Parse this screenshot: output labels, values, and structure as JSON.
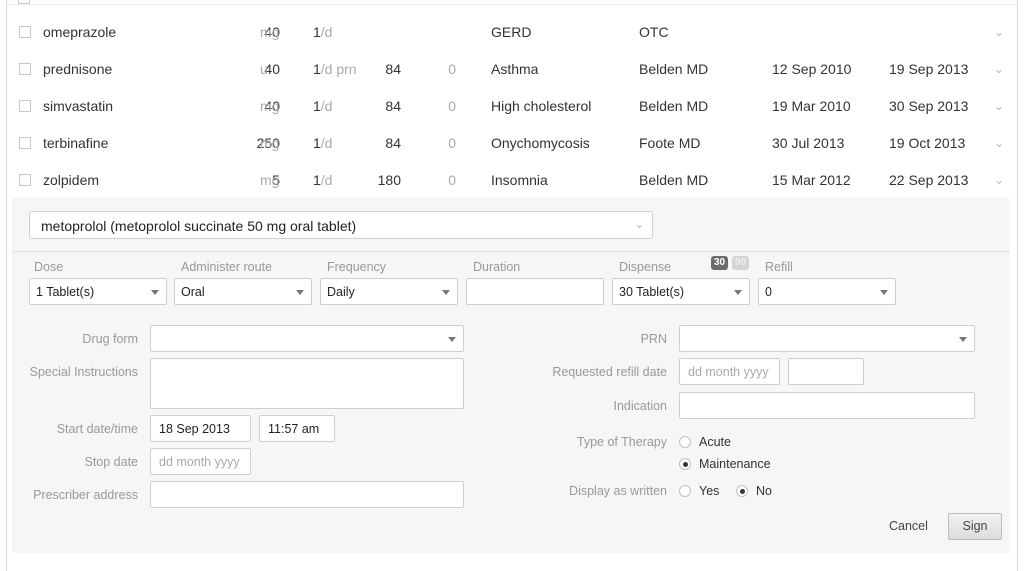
{
  "med_list": [
    {
      "name": "omeprazole",
      "dose": "40",
      "unit": "mg",
      "freq_num": "1",
      "freq_per": "/d",
      "quantity": "",
      "refills": "",
      "indication": "GERD",
      "prescriber": "OTC",
      "start": "",
      "end": ""
    },
    {
      "name": "prednisone",
      "dose": "40",
      "unit": "u",
      "freq_num": "1",
      "freq_per": "/d prn",
      "quantity": "84",
      "refills": "0",
      "indication": "Asthma",
      "prescriber": "Belden MD",
      "start": "12 Sep 2010",
      "end": "19 Sep 2013"
    },
    {
      "name": "simvastatin",
      "dose": "40",
      "unit": "mg",
      "freq_num": "1",
      "freq_per": "/d",
      "quantity": "84",
      "refills": "0",
      "indication": "High cholesterol",
      "prescriber": "Belden MD",
      "start": "19 Mar 2010",
      "end": "30 Sep 2013"
    },
    {
      "name": "terbinafine",
      "dose": "250",
      "unit": "mg",
      "freq_num": "1",
      "freq_per": "/d",
      "quantity": "84",
      "refills": "0",
      "indication": "Onychomycosis",
      "prescriber": "Foote MD",
      "start": "30  Jul  2013",
      "end": "19 Oct 2013"
    },
    {
      "name": "zolpidem",
      "dose": "5",
      "unit": "mg",
      "freq_num": "1",
      "freq_per": "/d",
      "quantity": "180",
      "refills": "0",
      "indication": "Insomnia",
      "prescriber": "Belden MD",
      "start": "15 Mar 2012",
      "end": "22 Sep 2013"
    }
  ],
  "order": {
    "drug": "metoprolol (metoprolol succinate 50 mg oral tablet)",
    "labels": {
      "dose": "Dose",
      "route": "Administer route",
      "frequency": "Frequency",
      "duration": "Duration",
      "dispense": "Dispense",
      "refill": "Refill"
    },
    "values": {
      "dose": "1 Tablet(s)",
      "route": "Oral",
      "frequency": "Daily",
      "duration": "",
      "dispense": "30 Tablet(s)",
      "refill": "0"
    },
    "dispense_badges": [
      "30",
      "90"
    ]
  },
  "details_left": {
    "drug_form_label": "Drug form",
    "special_instructions_label": "Special Instructions",
    "start_label": "Start date/time",
    "start_date": "18 Sep 2013",
    "start_time": "11:57 am",
    "stop_label": "Stop date",
    "stop_placeholder": "dd month yyyy",
    "prescriber_address_label": "Prescriber address"
  },
  "details_right": {
    "prn_label": "PRN",
    "refill_date_label": "Requested refill date",
    "refill_date_placeholder": "dd month yyyy",
    "indication_label": "Indication",
    "therapy_label": "Type of Therapy",
    "therapy_options": [
      "Acute",
      "Maintenance"
    ],
    "therapy_selected": "Maintenance",
    "daw_label": "Display as written",
    "daw_options": [
      "Yes",
      "No"
    ],
    "daw_selected": "No"
  },
  "actions": {
    "cancel": "Cancel",
    "sign": "Sign"
  }
}
